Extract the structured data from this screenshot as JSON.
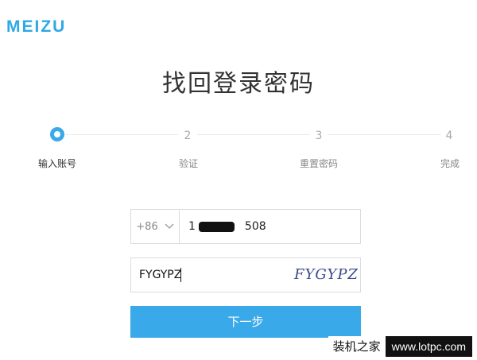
{
  "brand": {
    "logo": "MEIZU",
    "color": "#2fa8e6"
  },
  "page": {
    "title": "找回登录密码"
  },
  "steps": [
    {
      "num": "1",
      "label": "输入账号",
      "active": true
    },
    {
      "num": "2",
      "label": "验证",
      "active": false
    },
    {
      "num": "3",
      "label": "重置密码",
      "active": false
    },
    {
      "num": "4",
      "label": "完成",
      "active": false
    }
  ],
  "form": {
    "country_code": "+86",
    "phone_prefix": "1",
    "phone_suffix": "508",
    "captcha_value": "FYGYPZ",
    "captcha_image_text": "FYGYPZ"
  },
  "actions": {
    "next_label": "下一步",
    "accent": "#3aa9e9"
  },
  "watermark": {
    "cn": "装机之家",
    "url": "www.lotpc.com"
  }
}
